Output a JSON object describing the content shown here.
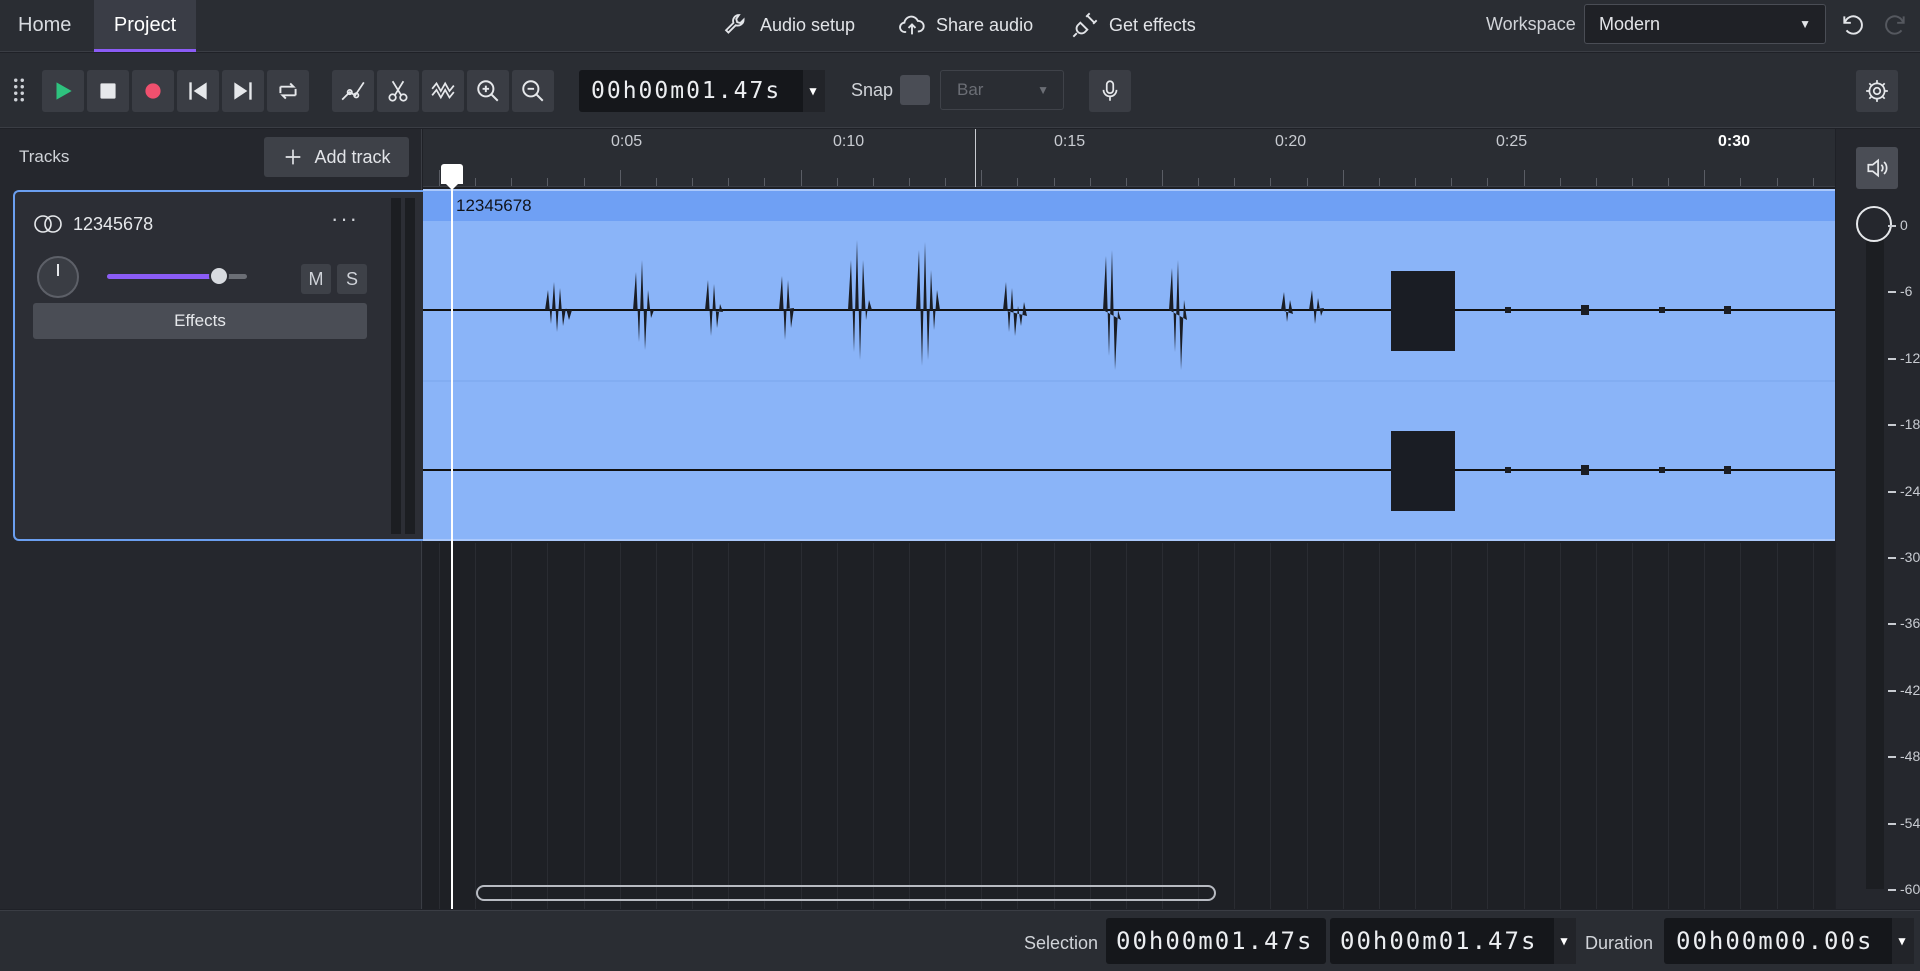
{
  "nav": {
    "home": "Home",
    "project": "Project"
  },
  "top_actions": {
    "audio_setup": "Audio setup",
    "share_audio": "Share audio",
    "get_effects": "Get effects"
  },
  "workspace": {
    "label": "Workspace",
    "value": "Modern"
  },
  "transport": {
    "time": "00h00m01.47s"
  },
  "snap": {
    "label": "Snap",
    "value": "Bar"
  },
  "tracks_panel": {
    "title": "Tracks",
    "add_track": "Add track"
  },
  "track": {
    "name": "12345678",
    "mute": "M",
    "solo": "S",
    "effects": "Effects",
    "volume_fraction": 0.8,
    "more": "···"
  },
  "clip": {
    "name": "12345678"
  },
  "ruler": {
    "labels": [
      "0:05",
      "0:10",
      "0:15",
      "0:20",
      "0:25",
      "0:30"
    ]
  },
  "meter": {
    "db_labels": [
      "0",
      "-6",
      "-12",
      "-18",
      "-24",
      "-30",
      "-36",
      "-42",
      "-48",
      "-54",
      "-60"
    ]
  },
  "bottom": {
    "selection_label": "Selection",
    "selection_start": "00h00m01.47s",
    "selection_end": "00h00m01.47s",
    "duration_label": "Duration",
    "duration": "00h00m00.00s"
  },
  "colors": {
    "accent": "#8b5cf6",
    "clip": "#8ab4f8",
    "clip_header": "#6fa0f4",
    "play": "#2ec27e",
    "record": "#f0506e"
  }
}
